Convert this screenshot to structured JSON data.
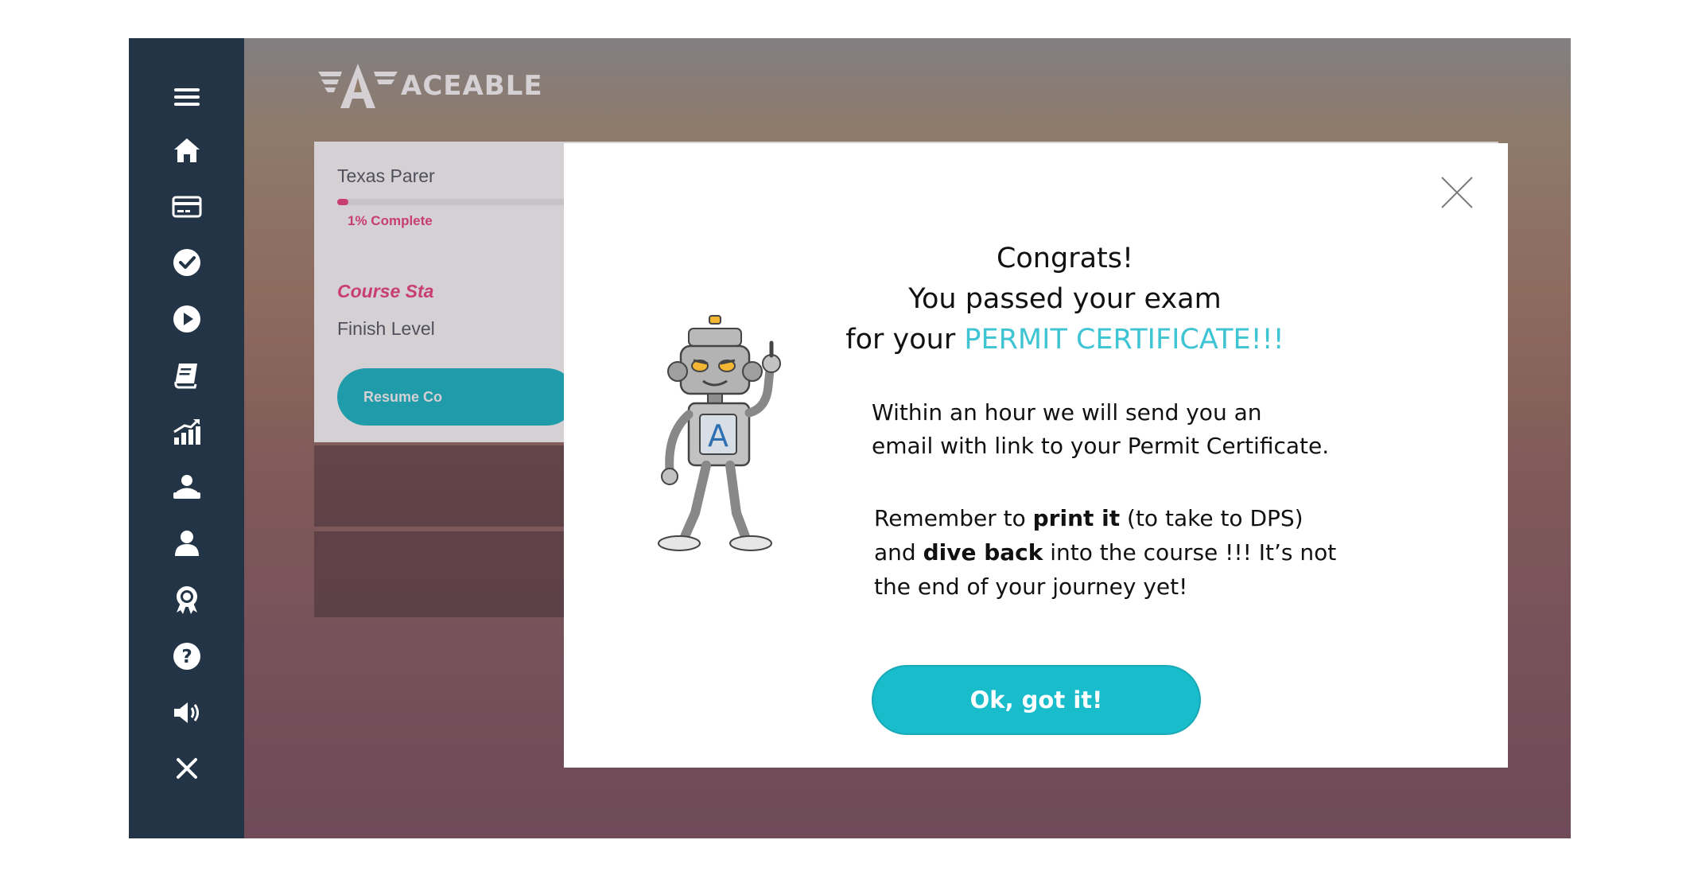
{
  "brand": {
    "logo_text": "ACEABLE",
    "logo_mark": "A"
  },
  "colors": {
    "sidebar": "#243447",
    "accent_teal": "#18bccb",
    "accent_pink": "#f0467f",
    "highlight": "#3ec4d3"
  },
  "sidebar": {
    "icons": [
      "menu-icon",
      "home-icon",
      "credit-card-icon",
      "check-circle-icon",
      "play-circle-icon",
      "book-icon",
      "chart-icon",
      "student-icon",
      "user-icon",
      "award-icon",
      "help-icon",
      "volume-icon",
      "close-icon"
    ]
  },
  "course": {
    "title": "Texas Parer",
    "progress_label": "1% Complete",
    "progress_fraction": 0.01,
    "status": "Course Sta",
    "finish": "Finish Level",
    "resume_label": "Resume Co"
  },
  "modal": {
    "line1": "Congrats!",
    "line2": "You passed your exam",
    "line3_prefix": "for your",
    "line3_highlight": "PERMIT CERTIFICATE!!!",
    "para1_line1": "Within an hour we will send you an",
    "para1_line2": "email with link to your Permit Certificate.",
    "para2_a": "Remember to ",
    "para2_b": "print it",
    "para2_c": " (to take to DPS)",
    "para2_d": "and ",
    "para2_e": "dive back",
    "para2_f": " into the course !!! It’s not",
    "para2_g": "the end of your journey yet!",
    "button": "Ok, got it!",
    "mascot_letter": "A"
  }
}
